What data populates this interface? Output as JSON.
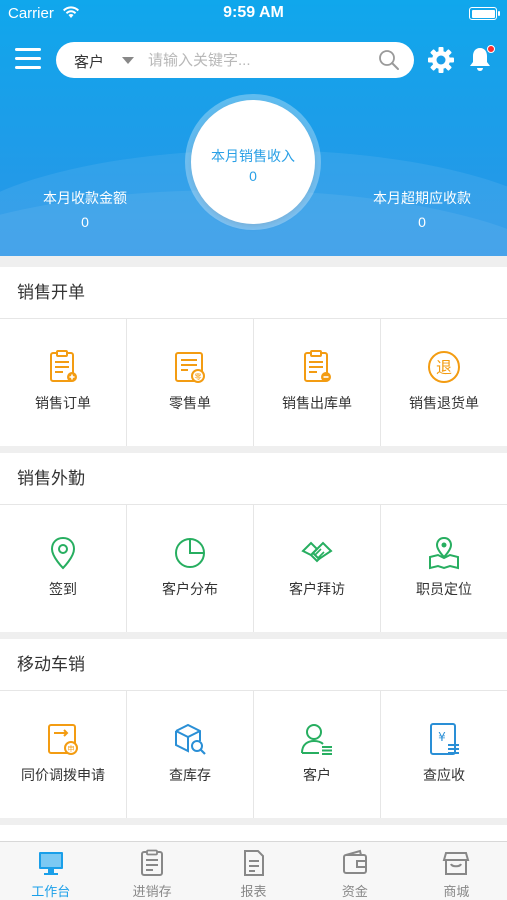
{
  "status_bar": {
    "carrier": "Carrier",
    "time": "9:59 AM"
  },
  "header": {
    "search": {
      "type_label": "客户",
      "placeholder": "请输入关键字..."
    },
    "center_stat": {
      "label": "本月销售收入",
      "value": "0"
    },
    "left_stat": {
      "label": "本月收款金额",
      "value": "0"
    },
    "right_stat": {
      "label": "本月超期应收款",
      "value": "0"
    },
    "notification_dot_color": "#ff2d2d"
  },
  "sections": [
    {
      "title": "销售开单",
      "items": [
        {
          "label": "销售订单",
          "icon": "sales-order-icon"
        },
        {
          "label": "零售单",
          "icon": "retail-bill-icon"
        },
        {
          "label": "销售出库单",
          "icon": "sales-outbound-icon"
        },
        {
          "label": "销售退货单",
          "icon": "sales-return-icon"
        }
      ]
    },
    {
      "title": "销售外勤",
      "items": [
        {
          "label": "签到",
          "icon": "location-pin-icon"
        },
        {
          "label": "客户分布",
          "icon": "pie-chart-icon"
        },
        {
          "label": "客户拜访",
          "icon": "handshake-icon"
        },
        {
          "label": "职员定位",
          "icon": "map-pin-icon"
        }
      ]
    },
    {
      "title": "移动车销",
      "items": [
        {
          "label": "同价调拨申请",
          "icon": "transfer-request-icon"
        },
        {
          "label": "查库存",
          "icon": "inventory-search-icon"
        },
        {
          "label": "客户",
          "icon": "customer-icon"
        },
        {
          "label": "查应收",
          "icon": "receivable-icon"
        }
      ]
    }
  ],
  "tabbar": [
    {
      "label": "工作台",
      "icon": "workbench-icon",
      "active": true
    },
    {
      "label": "进销存",
      "icon": "inventory-icon",
      "active": false
    },
    {
      "label": "报表",
      "icon": "report-icon",
      "active": false
    },
    {
      "label": "资金",
      "icon": "wallet-icon",
      "active": false
    },
    {
      "label": "商城",
      "icon": "store-icon",
      "active": false
    }
  ],
  "colors": {
    "accent_blue": "#1a9fe9",
    "orange_icons": "#f39c12",
    "green_icons": "#27ae60",
    "blue_icons": "#2a8fd6",
    "tab_inactive": "#888888"
  }
}
